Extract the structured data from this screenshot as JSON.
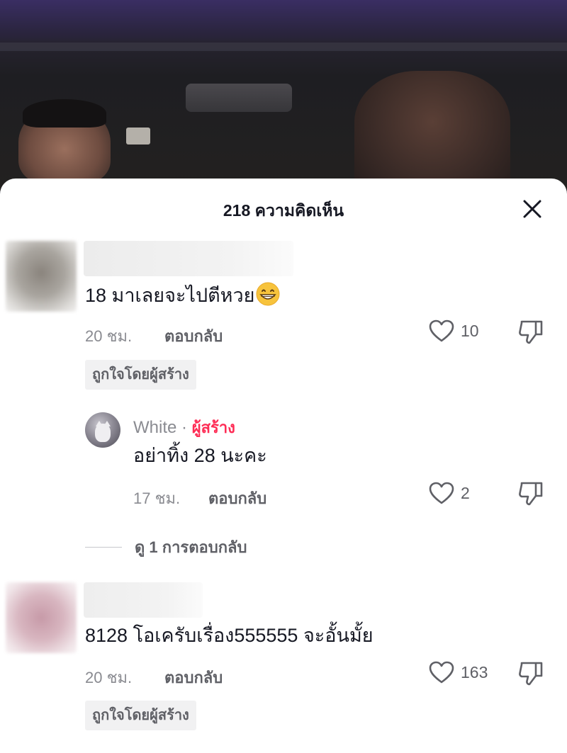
{
  "sheet": {
    "title": "218 ความคิดเห็น",
    "close_icon": "close-icon"
  },
  "comments": [
    {
      "text": "18 มาเลยจะไปตีหวย",
      "emoji": "😁",
      "time": "20 ชม.",
      "reply_label": "ตอบกลับ",
      "likes": "10",
      "creator_liked": "ถูกใจโดยผู้สร้าง",
      "avatar_color": "#9a9690",
      "reply": {
        "author": "White",
        "separator": " · ",
        "badge": "ผู้สร้าง",
        "text": "อย่าทิ้ง 28 นะคะ",
        "time": "17 ชม.",
        "reply_label": "ตอบกลับ",
        "likes": "2"
      },
      "view_replies": "ดู 1 การตอบกลับ"
    },
    {
      "text": "8128 โอเครับเรื่อง555555 จะอั้นมั้ย",
      "time": "20 ชม.",
      "reply_label": "ตอบกลับ",
      "likes": "163",
      "creator_liked": "ถูกใจโดยผู้สร้าง",
      "avatar_color": "#c9a2ad"
    }
  ],
  "colors": {
    "creator_badge": "#fe2c55",
    "text_primary": "#161823",
    "text_secondary": "#8a8b91"
  }
}
